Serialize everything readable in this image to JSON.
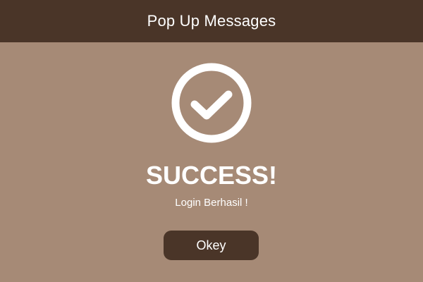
{
  "window": {
    "title": "Pop Up Messages"
  },
  "dialog": {
    "icon": "check-circle-icon",
    "headline": "SUCCESS!",
    "message": "Login Berhasil !",
    "button_label": "Okey"
  },
  "colors": {
    "header_background": "#4A3528",
    "page_background": "#A68A76",
    "button_background": "#4A3528",
    "text": "#FFFFFF",
    "icon": "#FFFFFF"
  }
}
